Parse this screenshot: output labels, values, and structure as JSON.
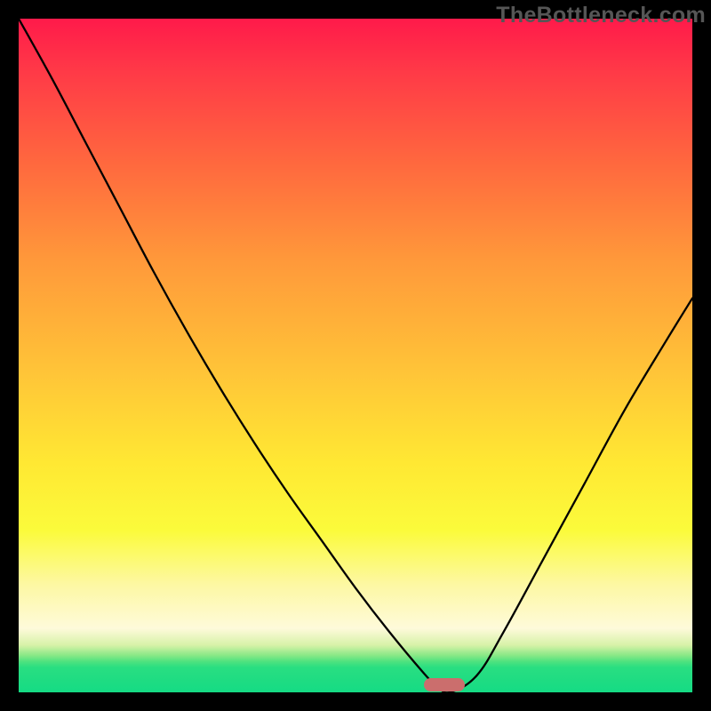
{
  "watermark": "TheBottleneck.com",
  "chart_data": {
    "type": "line",
    "title": "",
    "xlabel": "",
    "ylabel": "",
    "xlim": [
      0,
      1
    ],
    "ylim": [
      0,
      100
    ],
    "grid": false,
    "legend": false,
    "series": [
      {
        "name": "bottleneck-curve",
        "x": [
          0.0,
          0.05,
          0.1,
          0.15,
          0.2,
          0.25,
          0.3,
          0.35,
          0.4,
          0.45,
          0.5,
          0.55,
          0.6,
          0.62,
          0.64,
          0.68,
          0.72,
          0.78,
          0.84,
          0.9,
          0.96,
          1.0
        ],
        "y": [
          100.0,
          91.0,
          81.5,
          72.0,
          62.5,
          53.5,
          45.0,
          37.0,
          29.5,
          22.5,
          15.5,
          9.0,
          3.0,
          1.0,
          0.0,
          2.5,
          9.0,
          20.0,
          31.0,
          42.0,
          52.0,
          58.5
        ],
        "color": "#000000",
        "linewidth": 2.3
      }
    ],
    "marker": {
      "x_center": 0.632,
      "y": 0.0,
      "width_frac": 0.061,
      "color": "#cb6e6d"
    }
  },
  "colors": {
    "frame_border": "#000000",
    "gradient_top": "#ff1a4a",
    "gradient_bottom": "#15db84",
    "curve": "#000000",
    "marker": "#cb6e6d",
    "watermark": "#565656"
  }
}
